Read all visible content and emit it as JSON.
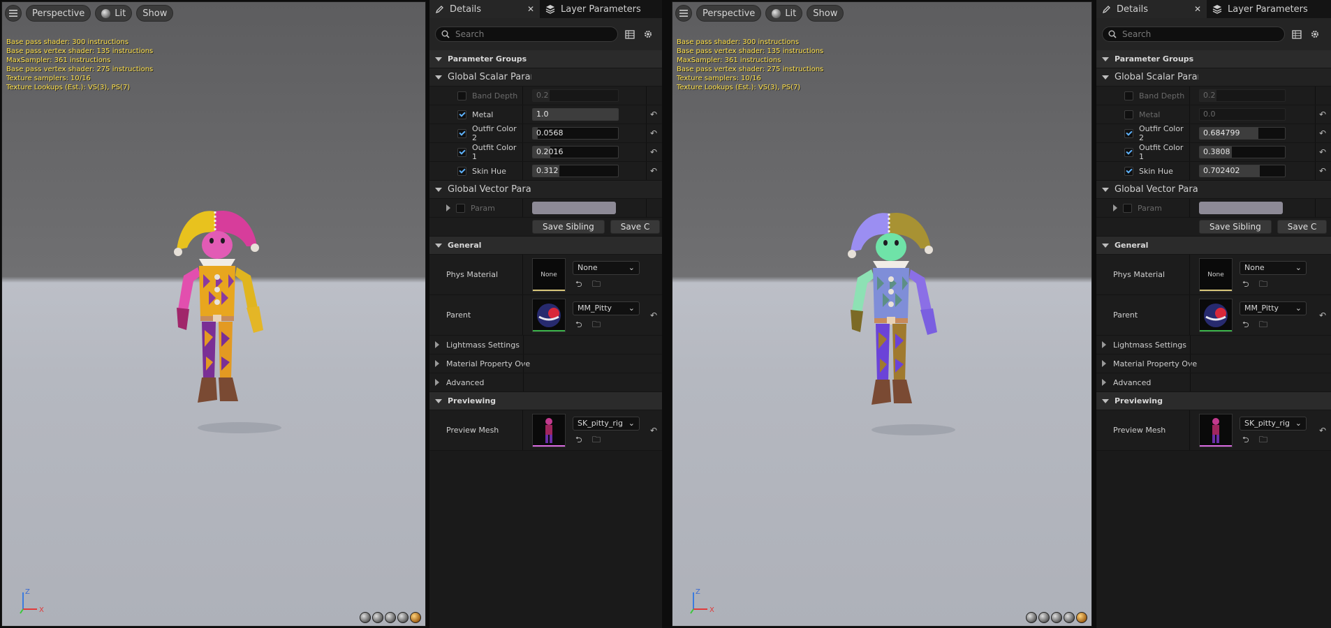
{
  "instances": [
    {
      "viewport": {
        "toolbar": {
          "perspective": "Perspective",
          "lit": "Lit",
          "show": "Show"
        },
        "stats": [
          "Base pass shader: 300 instructions",
          "Base pass vertex shader: 135 instructions",
          "MaxSampler: 361 instructions",
          "Base pass vertex shader: 275 instructions",
          "Texture samplers: 10/16",
          "Texture Lookups (Est.): VS(3), PS(7)"
        ],
        "axis": {
          "z": "Z",
          "x": "X"
        },
        "jester": {
          "hat_left": "#e8c21e",
          "hat_right": "#d73d9b",
          "face": "#e25bb5",
          "body_a": "#e8a61e",
          "body_b": "#8a3a9e",
          "arm_left": "#e24fae",
          "arm_right": "#e0b51f",
          "legs_a": "#7a2f95",
          "legs_b": "#e39a22",
          "glove_left": "#a0266a",
          "glove_right": "#e4b626"
        }
      },
      "panel": {
        "tabs": {
          "details": "Details",
          "close": "✕",
          "layer_params": "Layer Parameters"
        },
        "search_placeholder": "Search",
        "sections": {
          "parameter_groups": "Parameter Groups",
          "global_scalar": "Global Scalar Parar",
          "global_vector": "Global Vector Para",
          "general": "General",
          "previewing": "Previewing"
        },
        "scalars": [
          {
            "name": "Band Depth",
            "value": "0.2",
            "checked": false,
            "enabled": false,
            "fill": 0.2
          },
          {
            "name": "Metal",
            "value": "1.0",
            "checked": true,
            "enabled": true,
            "fill": 1.0
          },
          {
            "name": "Outfir Color 2",
            "value": "0.0568",
            "checked": true,
            "enabled": true,
            "fill": 0.0568
          },
          {
            "name": "Outfit Color 1",
            "value": "0.2016",
            "checked": true,
            "enabled": true,
            "fill": 0.2016
          },
          {
            "name": "Skin Hue",
            "value": "0.312",
            "checked": true,
            "enabled": true,
            "fill": 0.312
          }
        ],
        "vector_param": "Param",
        "buttons": {
          "save_sibling": "Save Sibling",
          "save_child": "Save C"
        },
        "phys_material": {
          "label": "Phys Material",
          "thumb": "None",
          "value": "None"
        },
        "parent": {
          "label": "Parent",
          "value": "MM_Pitty"
        },
        "collapsed": {
          "lightmass": "Lightmass Settings",
          "material_property": "Material Property Ove",
          "advanced": "Advanced"
        },
        "preview_mesh": {
          "label": "Preview Mesh",
          "value": "SK_pitty_rig"
        }
      }
    },
    {
      "viewport": {
        "toolbar": {
          "perspective": "Perspective",
          "lit": "Lit",
          "show": "Show"
        },
        "stats": [
          "Base pass shader: 300 instructions",
          "Base pass vertex shader: 135 instructions",
          "MaxSampler: 361 instructions",
          "Base pass vertex shader: 275 instructions",
          "Texture samplers: 10/16",
          "Texture Lookups (Est.): VS(3), PS(7)"
        ],
        "axis": {
          "z": "Z",
          "x": "X"
        },
        "jester": {
          "hat_left": "#9b8ef2",
          "hat_right": "#a89233",
          "face": "#6fe3a8",
          "body_a": "#7f8ed8",
          "body_b": "#5d8f86",
          "arm_left": "#8de1b4",
          "arm_right": "#8b6fe6",
          "legs_a": "#6b43d8",
          "legs_b": "#a07a2e",
          "glove_left": "#7c6a26",
          "glove_right": "#7a5fe0"
        }
      },
      "panel": {
        "tabs": {
          "details": "Details",
          "close": "✕",
          "layer_params": "Layer Parameters"
        },
        "search_placeholder": "Search",
        "sections": {
          "parameter_groups": "Parameter Groups",
          "global_scalar": "Global Scalar Parar",
          "global_vector": "Global Vector Para",
          "general": "General",
          "previewing": "Previewing"
        },
        "scalars": [
          {
            "name": "Band Depth",
            "value": "0.2",
            "checked": false,
            "enabled": false,
            "fill": 0.2
          },
          {
            "name": "Metal",
            "value": "0.0",
            "checked": false,
            "enabled": false,
            "fill": 0.0
          },
          {
            "name": "Outfir Color 2",
            "value": "0.684799",
            "checked": true,
            "enabled": true,
            "fill": 0.684799
          },
          {
            "name": "Outfit Color 1",
            "value": "0.3808",
            "checked": true,
            "enabled": true,
            "fill": 0.3808
          },
          {
            "name": "Skin Hue",
            "value": "0.702402",
            "checked": true,
            "enabled": true,
            "fill": 0.702402
          }
        ],
        "vector_param": "Param",
        "buttons": {
          "save_sibling": "Save Sibling",
          "save_child": "Save C"
        },
        "phys_material": {
          "label": "Phys Material",
          "thumb": "None",
          "value": "None"
        },
        "parent": {
          "label": "Parent",
          "value": "MM_Pitty"
        },
        "collapsed": {
          "lightmass": "Lightmass Settings",
          "material_property": "Material Property Ove",
          "advanced": "Advanced"
        },
        "preview_mesh": {
          "label": "Preview Mesh",
          "value": "SK_pitty_rig"
        }
      }
    }
  ]
}
